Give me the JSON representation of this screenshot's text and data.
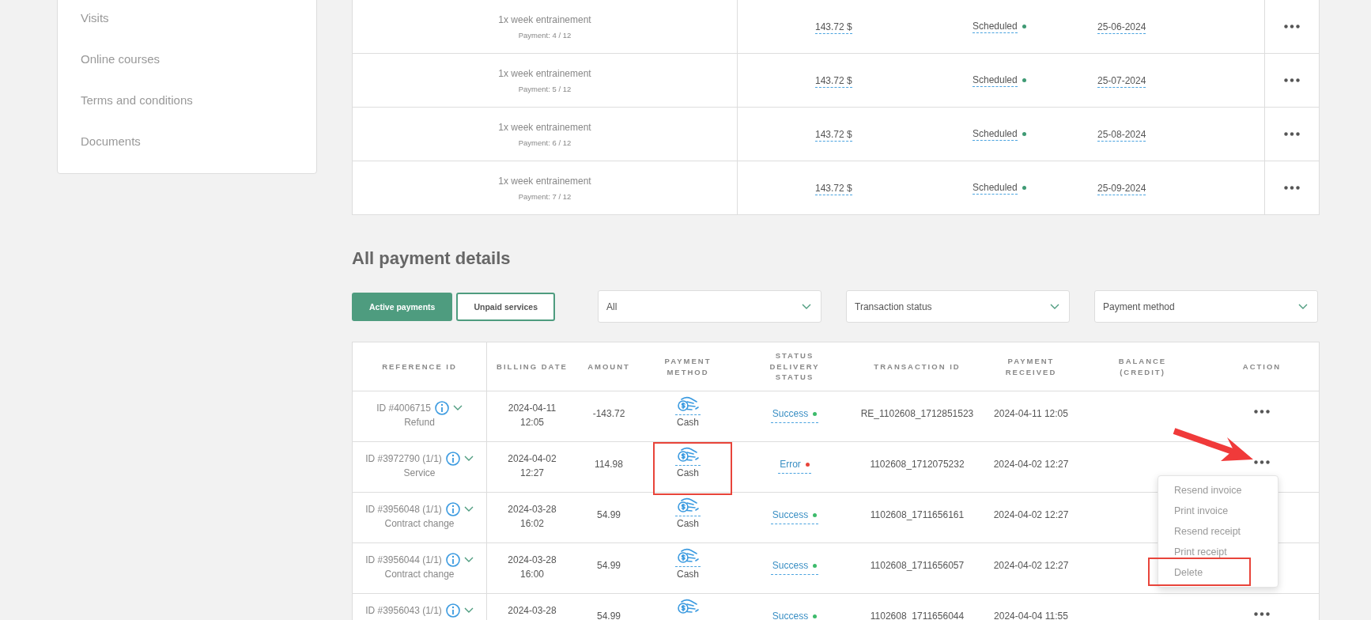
{
  "sidebar": {
    "items": [
      "Visits",
      "Online courses",
      "Terms and conditions",
      "Documents"
    ]
  },
  "schedule": {
    "rows": [
      {
        "title": "1x week entrainement",
        "payment": "Payment: 4 / 12",
        "amount": "143.72 $",
        "status": "Scheduled",
        "color": "#3f9a74",
        "date": "25-06-2024"
      },
      {
        "title": "1x week entrainement",
        "payment": "Payment: 5 / 12",
        "amount": "143.72 $",
        "status": "Scheduled",
        "color": "#3f9a74",
        "date": "25-07-2024"
      },
      {
        "title": "1x week entrainement",
        "payment": "Payment: 6 / 12",
        "amount": "143.72 $",
        "status": "Scheduled",
        "color": "#3f9a74",
        "date": "25-08-2024"
      },
      {
        "title": "1x week entrainement",
        "payment": "Payment: 7 / 12",
        "amount": "143.72 $",
        "status": "Scheduled",
        "color": "#3f9a74",
        "date": "25-09-2024"
      }
    ]
  },
  "payment_details": {
    "title": "All payment details",
    "toggle_buttons": [
      {
        "label": "Active payments",
        "selected": true
      },
      {
        "label": "Unpaid services",
        "selected": false
      }
    ],
    "filters": [
      {
        "value": "All"
      },
      {
        "value": "Transaction status"
      },
      {
        "value": "Payment method"
      }
    ],
    "table": {
      "columns": [
        "REFERENCE ID",
        "BILLING DATE",
        "AMOUNT",
        "PAYMENT\nMETHOD",
        "STATUS\nDELIVERY\nSTATUS",
        "TRANSACTION ID",
        "PAYMENT\nRECEIVED",
        "BALANCE\n(CREDIT)",
        "ACTION"
      ],
      "rows": [
        {
          "reference": "ID #4006715",
          "type": "Refund",
          "billing_date": "2024-04-11",
          "billing_time": "12:05",
          "amount": "-143.72",
          "method": "Cash",
          "method_highlighted": false,
          "status": "Success",
          "color": "#3dbb6b",
          "transaction_id": "RE_1102608_1712851523",
          "payment_received": "2024-04-11 12:05",
          "menu_open": false,
          "pointer_arrow": false
        },
        {
          "reference": "ID #3972790 (1/1)",
          "type": "Service",
          "billing_date": "2024-04-02",
          "billing_time": "12:27",
          "amount": "114.98",
          "method": "Cash",
          "method_highlighted": true,
          "status": "Error",
          "color": "#e8443a",
          "transaction_id": "1102608_1712075232",
          "payment_received": "2024-04-02 12:27",
          "menu_open": true,
          "pointer_arrow": true
        },
        {
          "reference": "ID #3956048 (1/1)",
          "type": "Contract change",
          "billing_date": "2024-03-28",
          "billing_time": "16:02",
          "amount": "54.99",
          "method": "Cash",
          "method_highlighted": false,
          "status": "Success",
          "color": "#3dbb6b",
          "transaction_id": "1102608_1711656161",
          "payment_received": "2024-04-02 12:27",
          "menu_open": false,
          "pointer_arrow": false
        },
        {
          "reference": "ID #3956044 (1/1)",
          "type": "Contract change",
          "billing_date": "2024-03-28",
          "billing_time": "16:00",
          "amount": "54.99",
          "method": "Cash",
          "method_highlighted": false,
          "status": "Success",
          "color": "#3dbb6b",
          "transaction_id": "1102608_1711656057",
          "payment_received": "2024-04-02 12:27",
          "menu_open": false,
          "pointer_arrow": false
        },
        {
          "reference": "ID #3956043 (1/1)",
          "billing_date": "2024-03-28",
          "amount": "54.99",
          "status": "Success",
          "color": "#3dbb6b",
          "transaction_id": "1102608_1711656044",
          "payment_received": "2024-04-04 11:55",
          "menu_open": false,
          "pointer_arrow": false
        }
      ]
    },
    "context_menu": {
      "items": [
        {
          "label": "Resend invoice",
          "highlighted": false
        },
        {
          "label": "Print invoice",
          "highlighted": false
        },
        {
          "label": "Resend receipt",
          "highlighted": false
        },
        {
          "label": "Print receipt",
          "highlighted": false
        },
        {
          "label": "Delete",
          "highlighted": true
        }
      ]
    }
  }
}
